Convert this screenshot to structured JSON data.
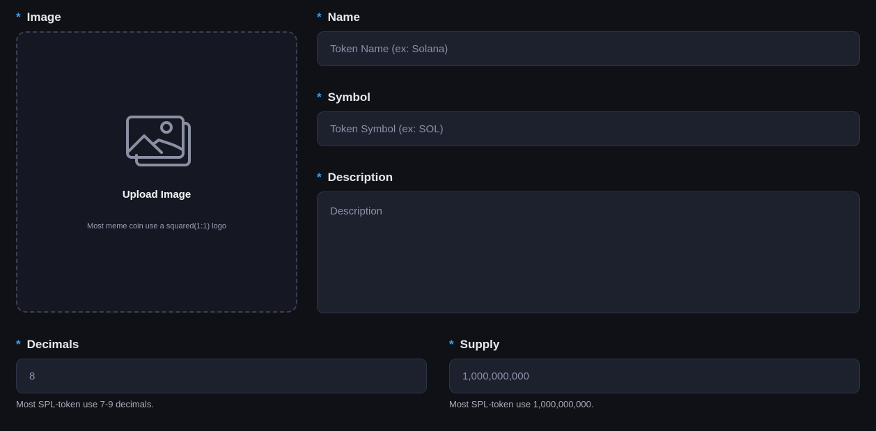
{
  "image": {
    "label": "Image",
    "required_mark": "*",
    "icon": "image-gallery-icon",
    "title": "Upload Image",
    "hint": "Most meme coin use a squared(1:1) logo"
  },
  "name": {
    "label": "Name",
    "required_mark": "*",
    "placeholder": "Token Name (ex: Solana)",
    "value": ""
  },
  "symbol": {
    "label": "Symbol",
    "required_mark": "*",
    "placeholder": "Token Symbol (ex: SOL)",
    "value": ""
  },
  "description": {
    "label": "Description",
    "required_mark": "*",
    "placeholder": "Description",
    "value": ""
  },
  "decimals": {
    "label": "Decimals",
    "required_mark": "*",
    "value": "8",
    "help": "Most SPL-token use 7-9 decimals."
  },
  "supply": {
    "label": "Supply",
    "required_mark": "*",
    "value": "1,000,000,000",
    "help": "Most SPL-token use 1,000,000,000."
  },
  "colors": {
    "background": "#101117",
    "field_bg": "#1d202d",
    "required_accent": "#3b9ff0"
  }
}
